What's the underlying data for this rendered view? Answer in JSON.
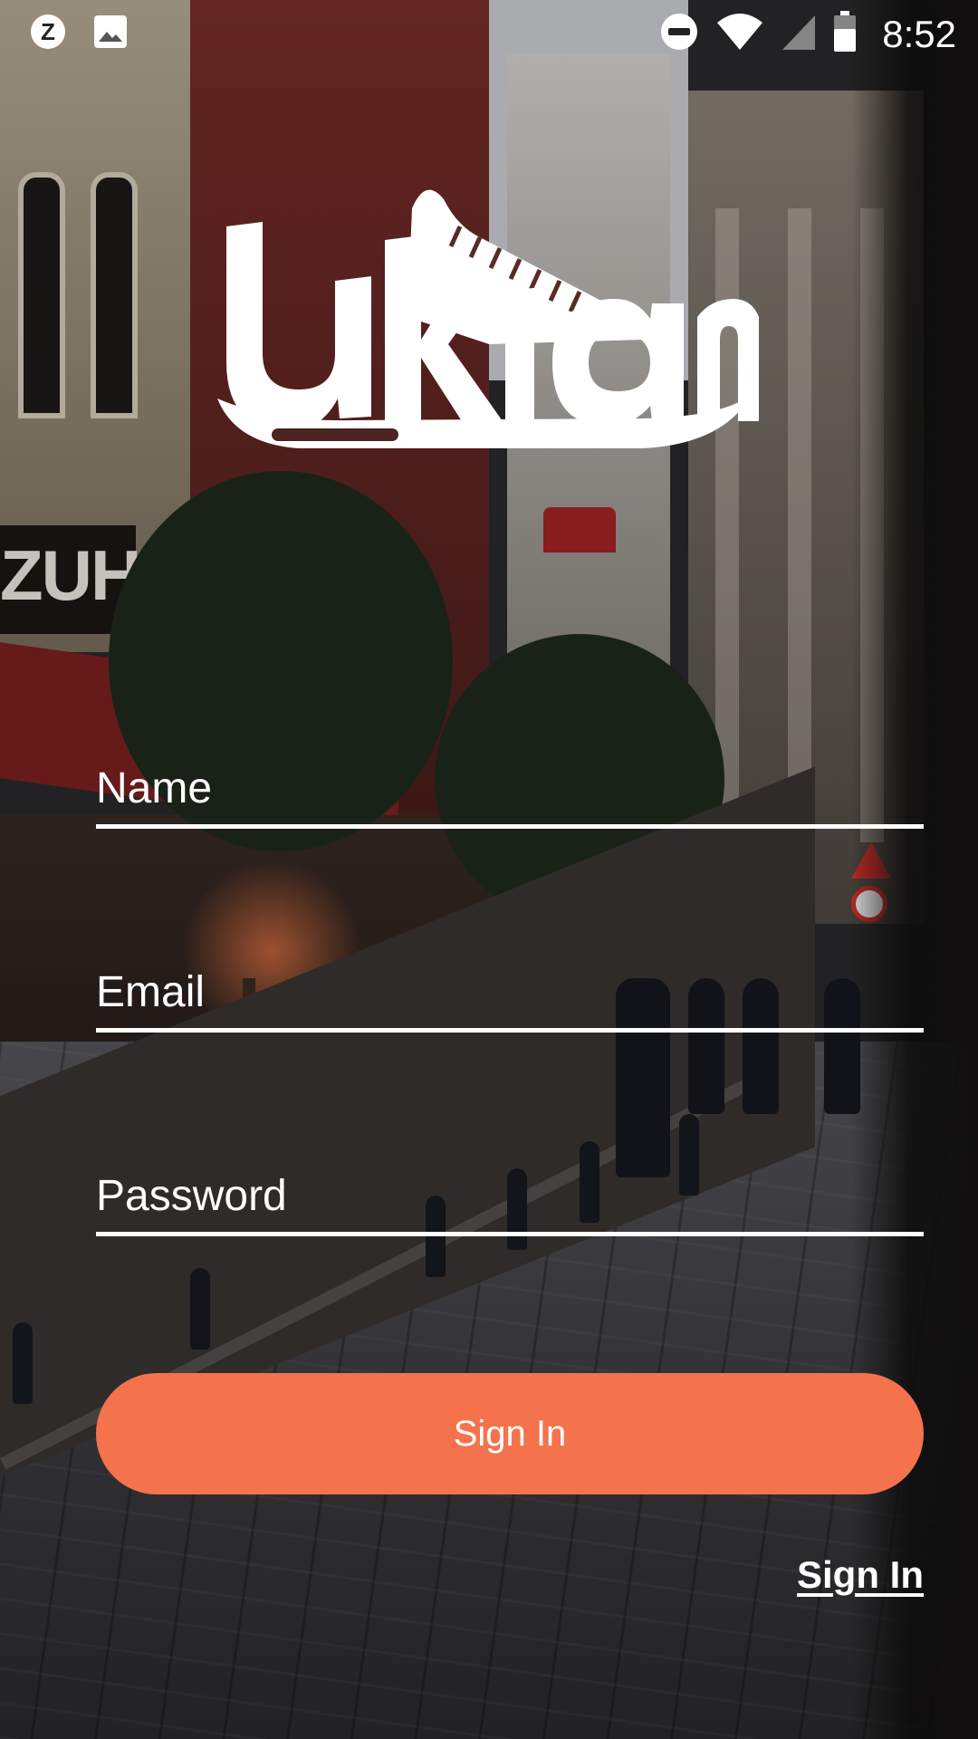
{
  "status_bar": {
    "left_icons": [
      "z-app-icon",
      "image-icon"
    ],
    "z_letter": "Z",
    "right_icons": [
      "do-not-disturb-icon",
      "wifi-icon",
      "cellular-signal-icon",
      "battery-icon"
    ],
    "time": "8:52"
  },
  "logo": {
    "text": "uklam"
  },
  "form": {
    "name_placeholder": "Name",
    "email_placeholder": "Email",
    "password_placeholder": "Password",
    "submit_label": "Sign In",
    "secondary_link": "Sign In"
  },
  "colors": {
    "accent": "#f4734c",
    "text": "#ffffff"
  }
}
